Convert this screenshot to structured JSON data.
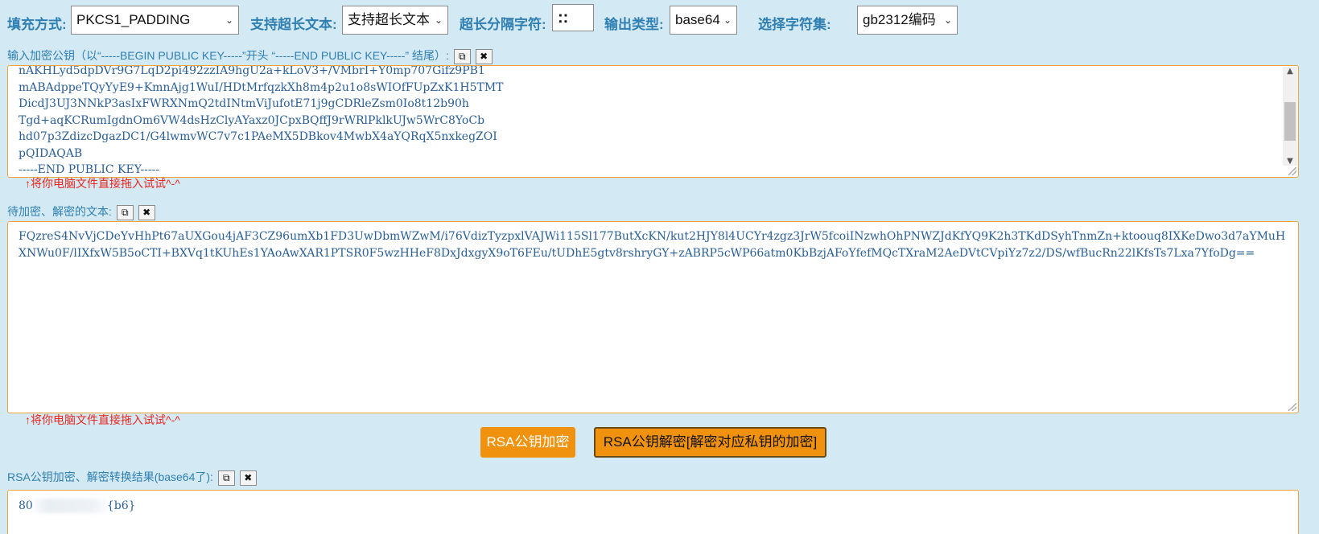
{
  "options": {
    "padding_label": "填充方式:",
    "padding_value": "PKCS1_PADDING",
    "longtext_label": "支持超长文本:",
    "longtext_value": "支持超长文本",
    "separator_label": "超长分隔字符:",
    "separator_value": "::",
    "output_label": "输出类型:",
    "output_value": "base64",
    "charset_label": "选择字符集:",
    "charset_value": "gb2312编码"
  },
  "public_key": {
    "label": "输入加密公钥（以“-----BEGIN PUBLIC KEY-----”开头 “-----END PUBLIC KEY-----” 结尾）:",
    "lines": [
      "nAKHLyd5dpDVr9G7LqD2pi492zzIA9hgU2a+kLoV3+/VMbrI+Y0mp707Gifz9PB1",
      "mABAdppeTQyYyE9+KmnAjg1WuI/HDtMrfqzkXh8m4p2u1o8sWIOfFUpZxK1H5TMT",
      "DicdJ3UJ3NNkP3asIxFWRXNmQ2tdINtmViJufotE71j9gCDRleZsm0Io8t12b90h",
      "Tgd+aqKCRumIgdnOm6VW4dsHzClyAYaxz0JCpxBQffJ9rWRlPklkUJw5WrC8YoCb",
      "hd07p3ZdizcDgazDC1/G4lwmvWC7v7c1PAeMX5DBkov4MwbX4aYQRqX5nxkegZOI",
      "pQIDAQAB",
      "-----END PUBLIC KEY-----"
    ],
    "hint": "↑将你电脑文件直接拖入试试^-^"
  },
  "input_text": {
    "label": "待加密、解密的文本:",
    "value": "FQzreS4NvVjCDeYvHhPt67aUXGou4jAF3CZ96umXb1FD3UwDbmWZwM/i76VdizTyzpxlVAJWi115Sl177ButXcKN/kut2HJY8l4UCYr4zgz3JrW5fcoiINzwhOhPNWZJdKfYQ9K2h3TKdDSyhTnmZn+ktoouq8IXKeDwo3d7aYMuHXNWu0F/lIXfxW5B5oCTI+BXVq1tKUhEs1YAoAwXAR1PTSR0F5wzHHeF8DxJdxgyX9oT6FEu/tUDhE5gtv8rshryGY+zABRP5cWP66atm0KbBzjAFoYfefMQcTXraM2AeDVtCVpiYz7z2/DS/wfBucRn22lKfsTs7Lxa7YfoDg==",
    "hint": "↑将你电脑文件直接拖入试试^-^"
  },
  "actions": {
    "encrypt_label": "RSA公钥加密",
    "decrypt_label": "RSA公钥解密[解密对应私钥的加密]"
  },
  "result": {
    "label": "RSA公钥加密、解密转换结果(base64了):",
    "value_prefix": "80",
    "value_suffix": "{b6}"
  },
  "icons": {
    "copy": "copy-icon",
    "clear": "close-icon"
  }
}
